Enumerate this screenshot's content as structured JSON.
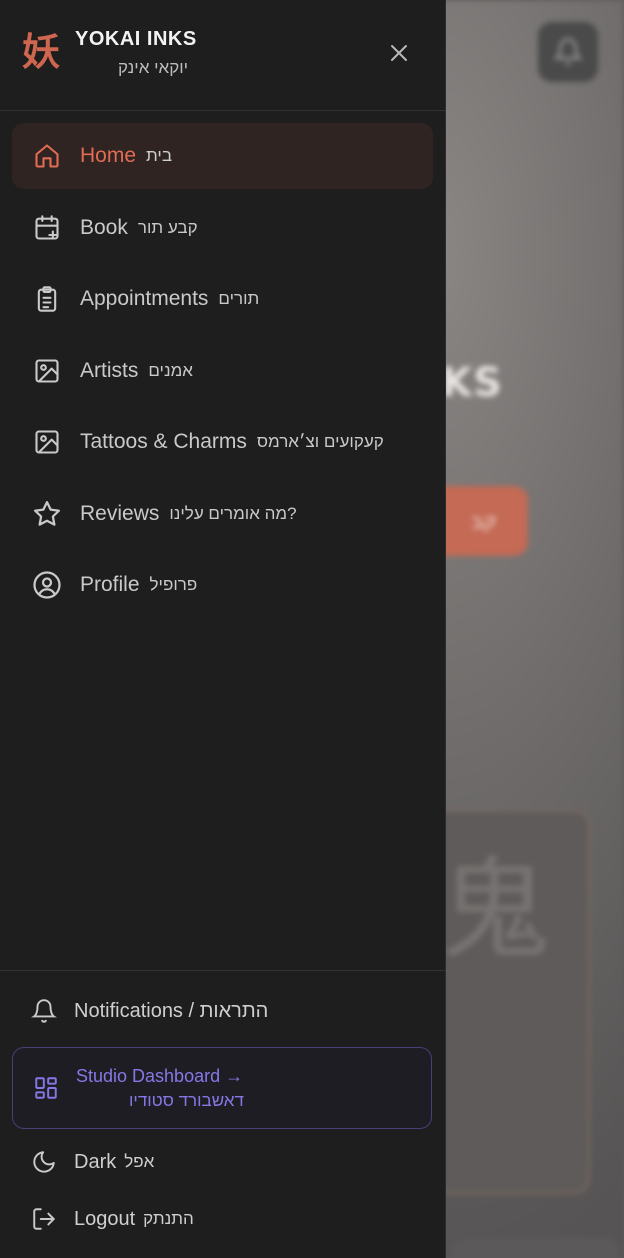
{
  "app": {
    "logo_glyph": "妖",
    "name": "YOKAI INKS",
    "name_he": "יוקאי אינק",
    "accent_color": "#e06c52"
  },
  "background": {
    "title_fragment": "I INKS",
    "cta_fragment": "קב",
    "card_glyph": "鬼"
  },
  "nav": {
    "items": [
      {
        "label": "Home",
        "label_he": "בית",
        "icon": "home-icon",
        "active": true
      },
      {
        "label": "Book",
        "label_he": "קבע תור",
        "icon": "calendar-plus-icon"
      },
      {
        "label": "Appointments",
        "label_he": "תורים",
        "icon": "clipboard-list-icon"
      },
      {
        "label": "Artists",
        "label_he": "אמנים",
        "icon": "image-icon"
      },
      {
        "label": "Tattoos & Charms",
        "label_he": "קעקועים וצ׳ארמס",
        "icon": "image-icon"
      },
      {
        "label": "Reviews",
        "label_he": "מה אומרים עלינו?",
        "icon": "star-icon"
      },
      {
        "label": "Profile",
        "label_he": "פרופיל",
        "icon": "user-circle-icon"
      }
    ]
  },
  "footer": {
    "notifications": "Notifications / התראות",
    "studio_dashboard": "Studio Dashboard →",
    "studio_dashboard_he": "דאשבורד סטודיו",
    "studio_color": "#8578e6",
    "dark_label": "Dark",
    "dark_label_he": "אפל",
    "logout_label": "Logout",
    "logout_label_he": "התנתק"
  }
}
